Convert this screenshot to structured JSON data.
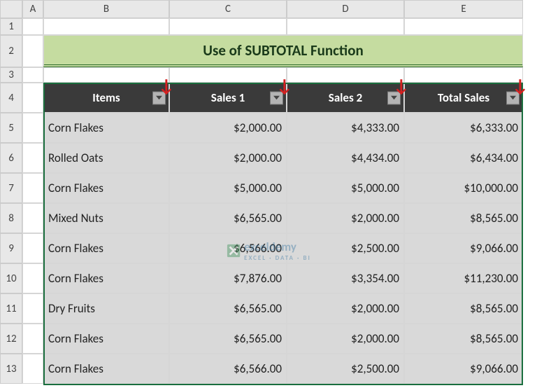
{
  "columns": [
    "",
    "A",
    "B",
    "C",
    "D",
    "E"
  ],
  "rows": [
    "1",
    "2",
    "3",
    "4",
    "5",
    "6",
    "7",
    "8",
    "9",
    "10",
    "11",
    "12",
    "13"
  ],
  "title": "Use of SUBTOTAL Function",
  "headers": [
    "Items",
    "Sales 1",
    "Sales 2",
    "Total Sales"
  ],
  "chart_data": {
    "type": "table",
    "title": "Use of SUBTOTAL Function",
    "columns": [
      "Items",
      "Sales 1",
      "Sales 2",
      "Total Sales"
    ],
    "rows": [
      {
        "items": "Corn Flakes",
        "s1": "$2,000.00",
        "s2": "$4,333.00",
        "tot": "$6,333.00"
      },
      {
        "items": "Rolled Oats",
        "s1": "$2,000.00",
        "s2": "$4,434.00",
        "tot": "$6,434.00"
      },
      {
        "items": "Corn Flakes",
        "s1": "$5,000.00",
        "s2": "$5,000.00",
        "tot": "$10,000.00"
      },
      {
        "items": "Mixed Nuts",
        "s1": "$6,565.00",
        "s2": "$2,000.00",
        "tot": "$8,565.00"
      },
      {
        "items": "Corn Flakes",
        "s1": "$6,566.00",
        "s2": "$2,500.00",
        "tot": "$9,066.00"
      },
      {
        "items": "Corn Flakes",
        "s1": "$7,876.00",
        "s2": "$3,354.00",
        "tot": "$11,230.00"
      },
      {
        "items": "Dry Fruits",
        "s1": "$6,565.00",
        "s2": "$2,000.00",
        "tot": "$8,565.00"
      },
      {
        "items": "Corn Flakes",
        "s1": "$6,565.00",
        "s2": "$2,000.00",
        "tot": "$8,565.00"
      },
      {
        "items": "Corn Flakes",
        "s1": "$6,566.00",
        "s2": "$2,500.00",
        "tot": "$9,066.00"
      }
    ]
  },
  "watermark": {
    "brand": "exceldemy",
    "tagline": "EXCEL · DATA · BI"
  }
}
